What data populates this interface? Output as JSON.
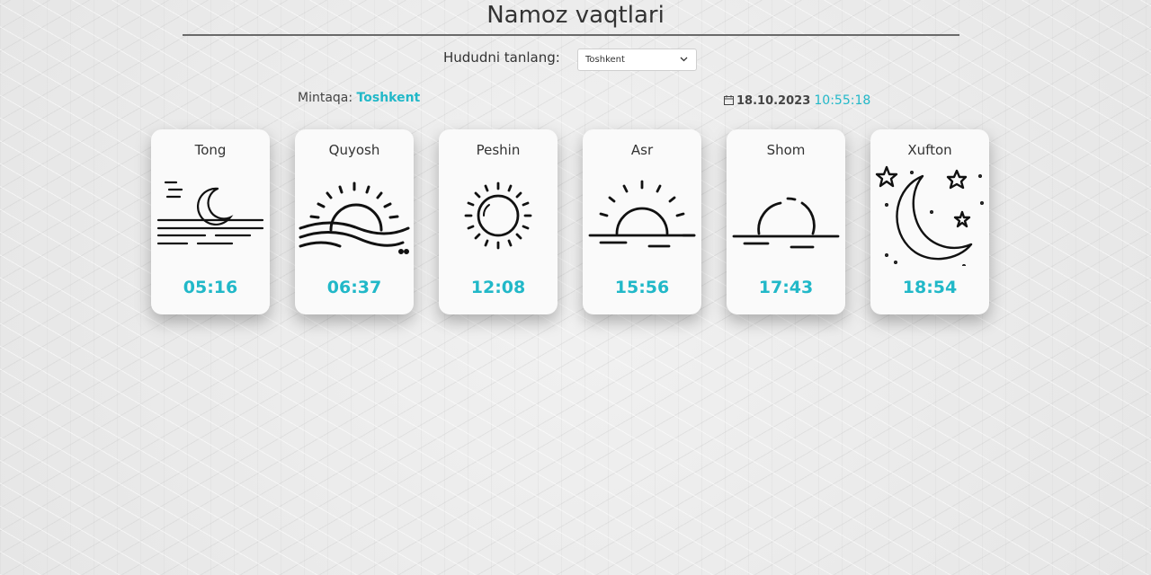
{
  "header": {
    "title": "Namoz vaqtlari"
  },
  "region": {
    "label": "Hududni tanlang:",
    "selected": "Toshkent",
    "current_label": "Mintaqa:",
    "current_value": "Toshkent"
  },
  "clock": {
    "date": "18.10.2023",
    "time": "10:55:18"
  },
  "prayers": [
    {
      "name": "Tong",
      "time": "05:16",
      "icon": "moonrise-icon"
    },
    {
      "name": "Quyosh",
      "time": "06:37",
      "icon": "sunrise-icon"
    },
    {
      "name": "Peshin",
      "time": "12:08",
      "icon": "sun-icon"
    },
    {
      "name": "Asr",
      "time": "15:56",
      "icon": "sunset-icon"
    },
    {
      "name": "Shom",
      "time": "17:43",
      "icon": "dusk-icon"
    },
    {
      "name": "Xufton",
      "time": "18:54",
      "icon": "crescent-moon-stars-icon"
    }
  ],
  "colors": {
    "accent": "#21b8c8",
    "text": "#333333",
    "card": "#fafafa"
  }
}
